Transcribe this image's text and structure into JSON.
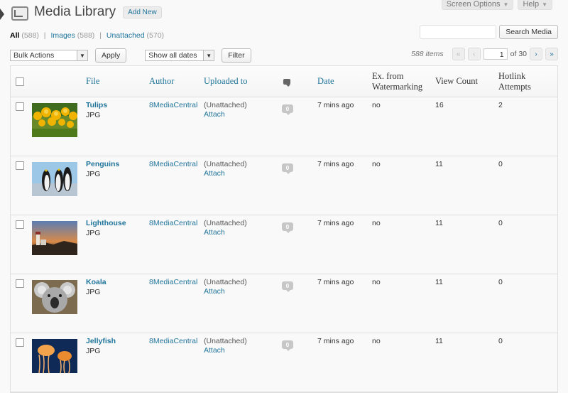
{
  "top_tabs": [
    {
      "label": "Screen Options"
    },
    {
      "label": "Help"
    }
  ],
  "header": {
    "title": "Media Library",
    "add_new": "Add New"
  },
  "filters": {
    "all": {
      "label": "All",
      "count": "(588)"
    },
    "images": {
      "label": "Images",
      "count": "(588)"
    },
    "unattached": {
      "label": "Unattached",
      "count": "(570)"
    },
    "separator": "|"
  },
  "search": {
    "button": "Search Media",
    "value": ""
  },
  "toolbar": {
    "bulk_actions": "Bulk Actions",
    "apply": "Apply",
    "dates": "Show all dates",
    "filter": "Filter"
  },
  "pagination": {
    "items": "588 items",
    "first": "«",
    "prev": "‹",
    "current_page": "1",
    "of_pages": "of 30",
    "next": "›",
    "last": "»"
  },
  "table": {
    "headers": {
      "file": "File",
      "author": "Author",
      "uploaded_to": "Uploaded to",
      "date": "Date",
      "watermarking": "Ex. from Watermarking",
      "view_count": "View Count",
      "hotlink": "Hotlink Attempts"
    },
    "rows": [
      {
        "title": "Tulips",
        "type": "JPG",
        "author": "8MediaCentral",
        "status": "(Unattached)",
        "attach": "Attach",
        "comments": "0",
        "date": "7 mins ago",
        "watermark": "no",
        "views": "16",
        "hotlink": "2"
      },
      {
        "title": "Penguins",
        "type": "JPG",
        "author": "8MediaCentral",
        "status": "(Unattached)",
        "attach": "Attach",
        "comments": "0",
        "date": "7 mins ago",
        "watermark": "no",
        "views": "11",
        "hotlink": "0"
      },
      {
        "title": "Lighthouse",
        "type": "JPG",
        "author": "8MediaCentral",
        "status": "(Unattached)",
        "attach": "Attach",
        "comments": "0",
        "date": "7 mins ago",
        "watermark": "no",
        "views": "11",
        "hotlink": "0"
      },
      {
        "title": "Koala",
        "type": "JPG",
        "author": "8MediaCentral",
        "status": "(Unattached)",
        "attach": "Attach",
        "comments": "0",
        "date": "7 mins ago",
        "watermark": "no",
        "views": "11",
        "hotlink": "0"
      },
      {
        "title": "Jellyfish",
        "type": "JPG",
        "author": "8MediaCentral",
        "status": "(Unattached)",
        "attach": "Attach",
        "comments": "0",
        "date": "7 mins ago",
        "watermark": "no",
        "views": "11",
        "hotlink": "0"
      }
    ]
  },
  "colors": {
    "link": "#21759b",
    "background": "#f9f9f9",
    "border": "#dfdfdf"
  }
}
